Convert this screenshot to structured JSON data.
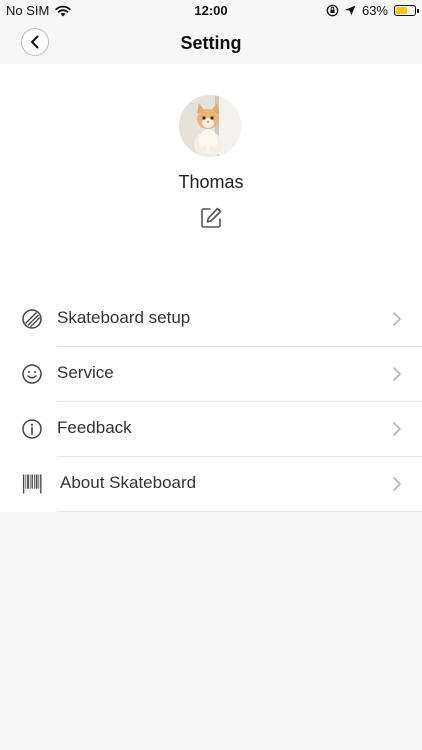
{
  "status_bar": {
    "carrier": "No SIM",
    "time": "12:00",
    "battery": "63%",
    "battery_level": 0.63,
    "battery_color": "#f5c518"
  },
  "nav": {
    "title": "Setting"
  },
  "profile": {
    "name": "Thomas"
  },
  "menu": {
    "items": [
      {
        "label": "Skateboard setup",
        "icon": "skateboard-icon"
      },
      {
        "label": "Service",
        "icon": "smiley-icon"
      },
      {
        "label": "Feedback",
        "icon": "info-icon"
      },
      {
        "label": "About Skateboard",
        "icon": "barcode-icon"
      }
    ]
  }
}
